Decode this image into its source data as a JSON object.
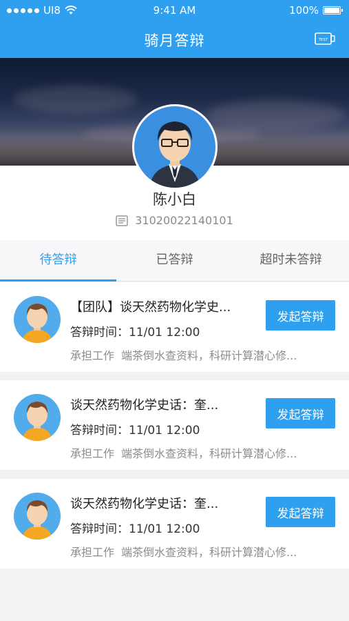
{
  "status_bar": {
    "carrier": "UI8",
    "time": "9:41 AM",
    "battery": "100%"
  },
  "nav": {
    "title": "骑月答辩",
    "action_icon": "test-badge-icon",
    "action_text": "TEST"
  },
  "profile": {
    "name": "陈小白",
    "student_id": "31020022140101"
  },
  "tabs": [
    {
      "label": "待答辩",
      "active": true
    },
    {
      "label": "已答辩",
      "active": false
    },
    {
      "label": "超时未答辩",
      "active": false
    }
  ],
  "cards": [
    {
      "title": "【团队】谈天然药物化学史...",
      "time_label": "答辩时间：",
      "time": "11/01 12:00",
      "desc_label": "承担工作",
      "desc": "端茶倒水查资料，科研计算潜心修...",
      "button": "发起答辩"
    },
    {
      "title": "谈天然药物化学史话：奎...",
      "time_label": "答辩时间：",
      "time": "11/01 12:00",
      "desc_label": "承担工作",
      "desc": "端茶倒水查资料，科研计算潜心修...",
      "button": "发起答辩"
    },
    {
      "title": "谈天然药物化学史话：奎...",
      "time_label": "答辩时间：",
      "time": "11/01 12:00",
      "desc_label": "承担工作",
      "desc": "端茶倒水查资料，科研计算潜心修...",
      "button": "发起答辩"
    }
  ],
  "colors": {
    "primary": "#2f9ff0",
    "tab_active": "#2f9ff0"
  }
}
